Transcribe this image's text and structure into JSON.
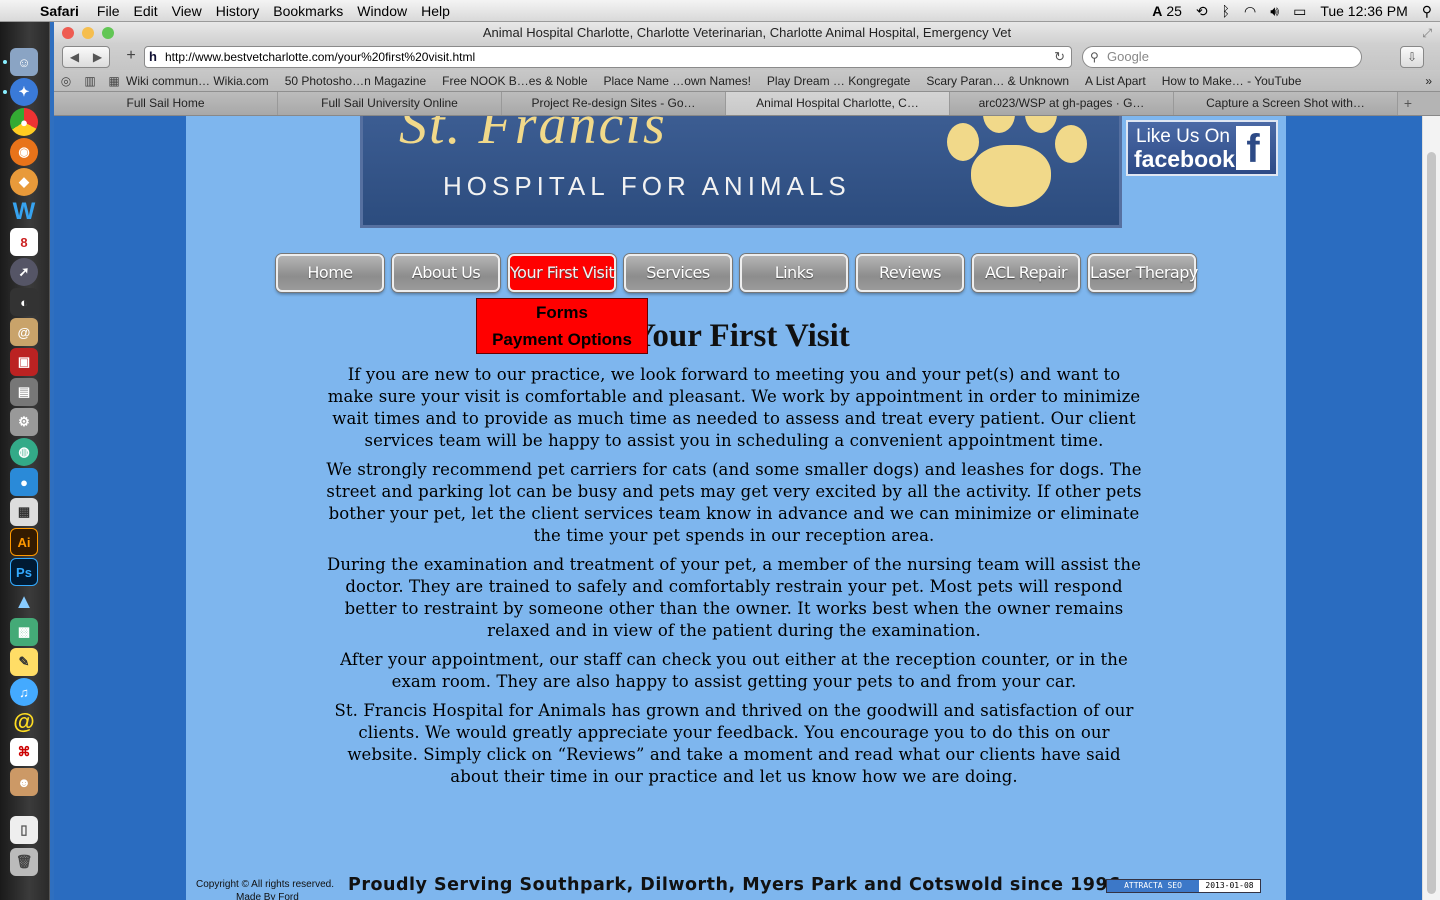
{
  "menubar": {
    "app": "Safari",
    "items": [
      "File",
      "Edit",
      "View",
      "History",
      "Bookmarks",
      "Window",
      "Help"
    ],
    "status": {
      "adobe": "25",
      "clock": "Tue 12:36 PM"
    }
  },
  "window": {
    "title": "Animal Hospital Charlotte, Charlotte Veterinarian, Charlotte Animal Hospital, Emergency Vet",
    "url": "http://www.bestvetcharlotte.com/your%20first%20visit.html",
    "search_placeholder": "Google",
    "bookmarks": [
      "Wiki commun… Wikia.com",
      "50 Photosho…n Magazine",
      "Free NOOK B…es & Noble",
      "Place Name …own Names!",
      "Play Dream … Kongregate",
      "Scary Paran… & Unknown",
      "A List Apart",
      "How to Make… - YouTube"
    ],
    "tabs": [
      "Full Sail Home",
      "Full Sail University Online",
      "Project Re-design Sites - Go…",
      "Animal Hospital Charlotte, C…",
      "arc023/WSP at gh-pages · G…",
      "Capture a Screen Shot with…"
    ],
    "active_tab": 3
  },
  "site": {
    "banner_title": "St. Francis",
    "banner_subtitle": "HOSPITAL FOR ANIMALS",
    "facebook": {
      "line1": "Like Us On",
      "line2": "facebook",
      "glyph": "f"
    },
    "nav": [
      "Home",
      "About Us",
      "Your First Visit",
      "Services",
      "Links",
      "Reviews",
      "ACL Repair",
      "Laser Therapy"
    ],
    "nav_active": "Your First Visit",
    "dropdown": [
      "Forms",
      "Payment Options"
    ],
    "heading": "Your First Visit",
    "paragraphs": [
      "If you are new to our practice, we look forward to meeting you and your pet(s) and want to make sure your visit is comfortable and pleasant. We work by appointment in order to minimize wait times and to provide as much time as needed to assess and treat every patient. Our client services team will be happy to assist you in scheduling a convenient appointment time.",
      "We strongly recommend pet carriers for cats (and some smaller dogs) and leashes for dogs. The street and parking lot can be busy and pets may get very excited by all the activity. If other pets bother your pet, let the client services team know in advance and we can minimize or eliminate the time your pet spends in our reception area.",
      "During the examination and treatment of your pet, a member of the nursing team will assist the doctor. They are trained to safely and comfortably restrain your pet. Most pets will respond better to restraint by someone other than the owner. It works best when the owner remains relaxed and in view of the patient during the examination.",
      "After your appointment, our staff can check you out either at the reception counter, or in the exam room. They are also happy to assist getting your pets to and from your car.",
      "St. Francis Hospital for Animals has grown and thrived on the goodwill and satisfaction of our clients. We would greatly appreciate your feedback. You encourage you to do this on our website. Simply click on “Reviews” and take a moment and read what our clients have said about their time in our practice and let us know how we are doing."
    ],
    "footer": {
      "copyright": "Copyright © All rights reserved.",
      "made_by": "Made By Ford",
      "tagline": "Proudly Serving Southpark, Dilworth, Myers Park and Cotswold since 1996",
      "badge_left": "ATTRACTA SEO",
      "badge_right": "2013-01-08"
    }
  },
  "colors": {
    "page_bg": "#7eb6ee",
    "outer_bg": "#2a6cc0",
    "nav_active": "#ff0000",
    "banner_gold": "#f1d98a"
  }
}
